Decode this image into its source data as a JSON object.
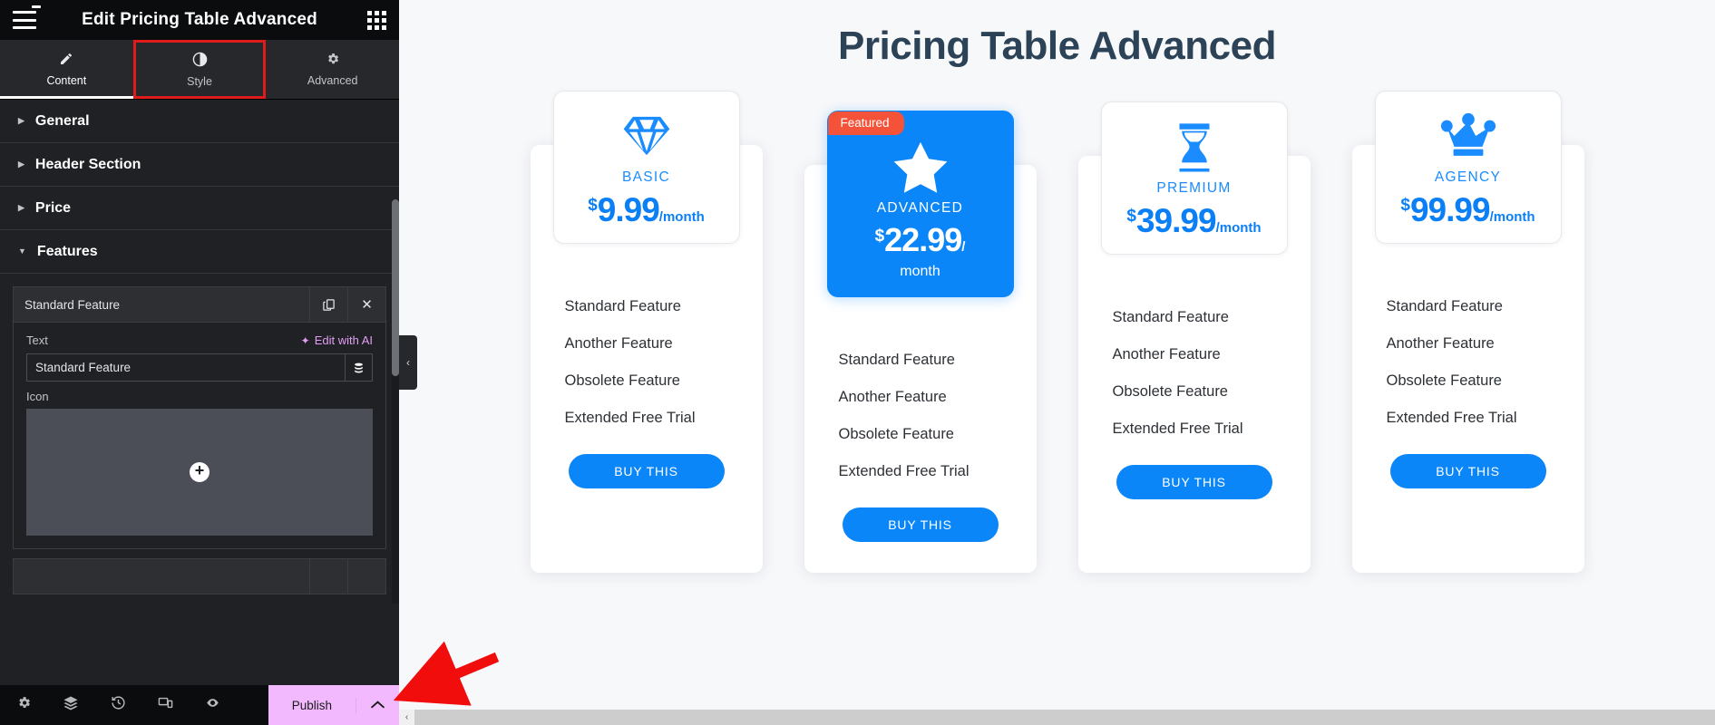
{
  "panel": {
    "title": "Edit Pricing Table Advanced",
    "menu_icon": "hamburger-icon",
    "apps_icon": "apps-grid-icon",
    "tabs": [
      {
        "label": "Content",
        "icon": "pencil-icon",
        "active": true
      },
      {
        "label": "Style",
        "icon": "contrast-icon",
        "active": false,
        "highlighted": true
      },
      {
        "label": "Advanced",
        "icon": "gear-icon",
        "active": false
      }
    ],
    "sections": [
      {
        "label": "General",
        "expanded": false
      },
      {
        "label": "Header Section",
        "expanded": false
      },
      {
        "label": "Price",
        "expanded": false
      },
      {
        "label": "Features",
        "expanded": true
      }
    ],
    "features_panel": {
      "repeater_item_label": "Standard Feature",
      "duplicate_icon": "duplicate-icon",
      "remove_icon": "close-icon",
      "text_label": "Text",
      "ai_link_label": "Edit with AI",
      "ai_icon": "sparkles-icon",
      "text_value": "Standard Feature",
      "text_placeholder": "Standard Feature",
      "dynamic_tags_icon": "database-icon",
      "icon_label": "Icon",
      "icon_add_glyph": "+"
    },
    "footer": {
      "icons": [
        {
          "name": "settings-gear-icon",
          "glyph": "⚙"
        },
        {
          "name": "navigator-layers-icon",
          "glyph": "⧉"
        },
        {
          "name": "history-icon",
          "glyph": "↺"
        },
        {
          "name": "responsive-mode-icon",
          "glyph": "⌸"
        },
        {
          "name": "preview-eye-icon",
          "glyph": "◉"
        }
      ],
      "publish_label": "Publish",
      "publish_caret": "▲",
      "publish_color": "#f3b9ff"
    }
  },
  "canvas": {
    "collapse_handle_glyph": "‹",
    "page_title": "Pricing Table Advanced",
    "accent_color": "#0b86f8",
    "title_color": "#2b4257",
    "ribbon_color": "#f4533a",
    "feature_items": [
      "Standard Feature",
      "Another Feature",
      "Obsolete Feature",
      "Extended Free Trial"
    ],
    "buy_label": "BUY THIS",
    "cards": [
      {
        "plan": "BASIC",
        "icon": "diamond-icon",
        "currency": "$",
        "amount": "9.99",
        "period": "/month",
        "featured": false,
        "ribbon": null,
        "offset": "low"
      },
      {
        "plan": "ADVANCED",
        "icon": "star-icon",
        "currency": "$",
        "amount": "22.99",
        "period": "/",
        "period_line2": "month",
        "featured": true,
        "ribbon": "Featured",
        "offset": "high"
      },
      {
        "plan": "PREMIUM",
        "icon": "hourglass-icon",
        "currency": "$",
        "amount": "39.99",
        "period": "/month",
        "featured": false,
        "ribbon": null,
        "offset": "mid"
      },
      {
        "plan": "AGENCY",
        "icon": "crown-icon",
        "currency": "$",
        "amount": "99.99",
        "period": "/month",
        "featured": false,
        "ribbon": null,
        "offset": "low"
      }
    ],
    "scrollbar_left_glyph": "‹"
  },
  "annotation": {
    "arrow_color": "#f20d0d",
    "arrow_target": "publish-caret-button"
  }
}
